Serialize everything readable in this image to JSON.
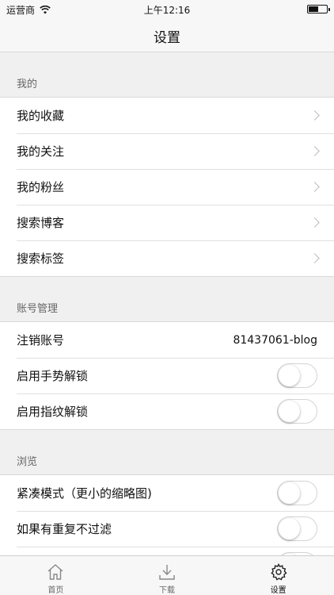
{
  "status": {
    "carrier": "运营商",
    "time": "上午12:16"
  },
  "nav": {
    "title": "设置"
  },
  "sections": [
    {
      "header": "我的",
      "rows": [
        {
          "label": "我的收藏"
        },
        {
          "label": "我的关注"
        },
        {
          "label": "我的粉丝"
        },
        {
          "label": "搜索博客"
        },
        {
          "label": "搜索标签"
        }
      ]
    },
    {
      "header": "账号管理",
      "rows": [
        {
          "label": "注销账号",
          "value": "81437061-blog"
        },
        {
          "label": "启用手势解锁",
          "toggle": false
        },
        {
          "label": "启用指纹解锁",
          "toggle": false
        }
      ]
    },
    {
      "header": "浏览",
      "rows": [
        {
          "label": "紧凑模式（更小的缩略图)",
          "toggle": false
        },
        {
          "label": "如果有重复不过滤",
          "toggle": false
        }
      ]
    }
  ],
  "tabs": [
    {
      "label": "首页",
      "icon": "home-icon"
    },
    {
      "label": "下载",
      "icon": "download-icon"
    },
    {
      "label": "设置",
      "icon": "gear-icon"
    }
  ],
  "colors": {
    "background": "#f0f0f0",
    "cell": "#ffffff",
    "separator": "#d9d9d9"
  }
}
